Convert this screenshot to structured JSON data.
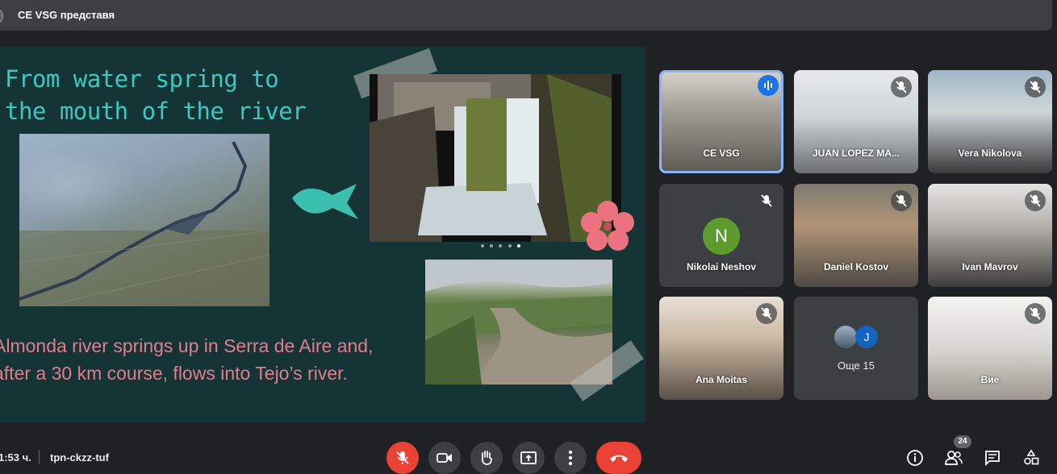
{
  "presenter_bar": {
    "label": "CE VSG представя"
  },
  "slide": {
    "title_line1": "From water spring to",
    "title_line2": "the mouth of the river",
    "caption_line1": "Almonda river springs up in Serra de Aire and,",
    "caption_line2": "after a 30 km course, flows into Tejo’s river.",
    "title_color": "#3fc7c1",
    "caption_color": "#e27d8f",
    "background_color": "#143436"
  },
  "participants": [
    {
      "name": "CE VSG",
      "state": "speaking"
    },
    {
      "name": "JUAN LOPEZ MA...",
      "state": "muted"
    },
    {
      "name": "Vera Nikolova",
      "state": "muted"
    },
    {
      "name": "Nikolai Neshov",
      "state": "muted",
      "initial": "N"
    },
    {
      "name": "Daniel Kostov",
      "state": "muted"
    },
    {
      "name": "Ivan Mavrov",
      "state": "muted"
    },
    {
      "name": "Ana Moitas",
      "state": "muted"
    },
    {
      "name": "Вие",
      "state": "muted"
    }
  ],
  "more_tile": {
    "initial": "J",
    "label": "Още 15"
  },
  "bottom_bar": {
    "time": "1:53 ч.",
    "meeting_code": "tpn-ckzz-tuf",
    "people_count": "24"
  },
  "colors": {
    "accent_blue": "#8ab4f8",
    "danger_red": "#ea4335",
    "surface": "#3c4043",
    "background": "#202124"
  }
}
